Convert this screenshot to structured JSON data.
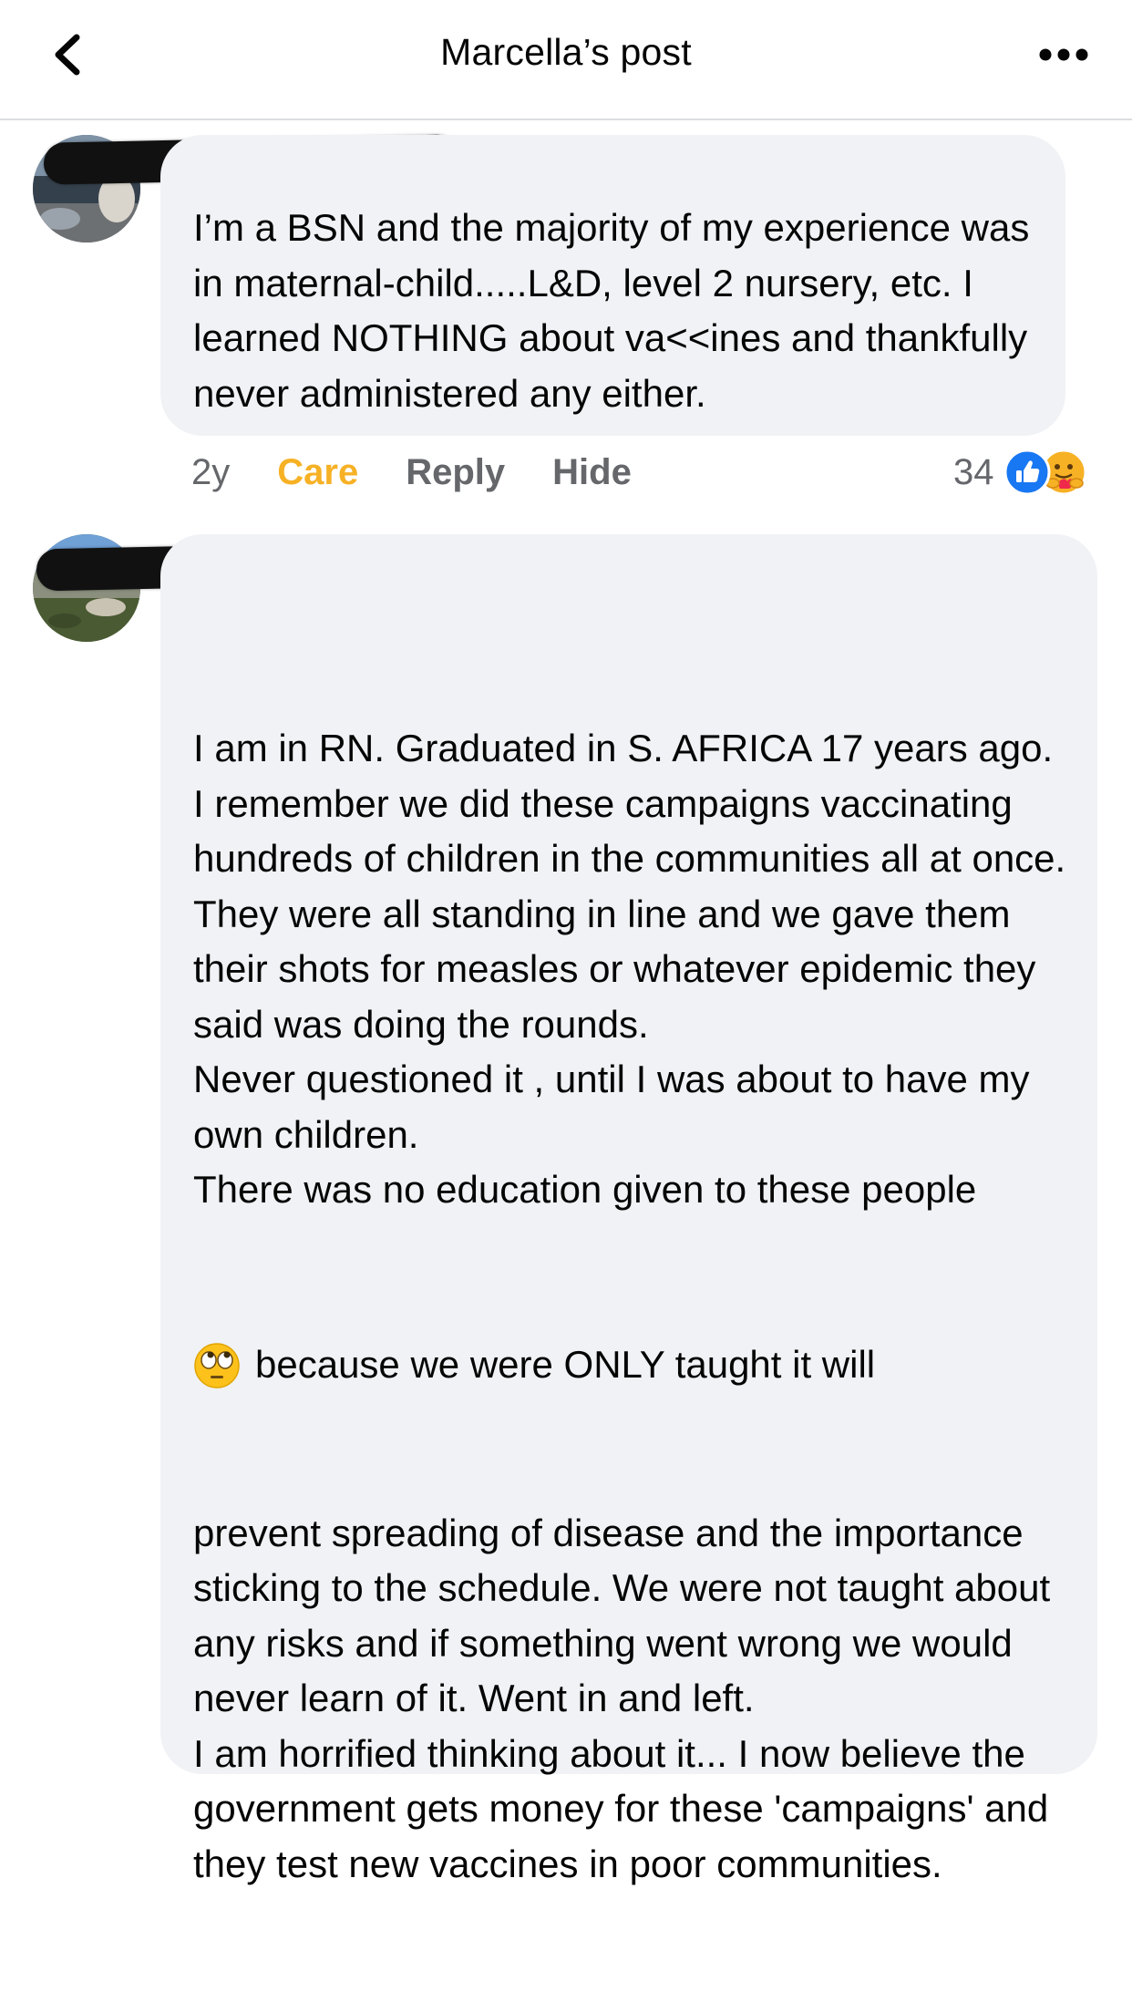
{
  "header": {
    "title": "Marcella’s post",
    "back_icon": "chevron-left-icon",
    "more_icon": "more-horizontal-icon"
  },
  "comments": [
    {
      "text": "I’m a BSN and the majority of my experience was in maternal-child.....L&D, level 2 nursery, etc. I learned NOTHING about va<<ines and thankfully never administered any either.",
      "time": "2y",
      "reaction_label": "Care",
      "reply_label": "Reply",
      "hide_label": "Hide",
      "reaction_count": "34",
      "reaction_icons": [
        "like-icon",
        "care-icon"
      ]
    },
    {
      "text_part1": "I am in RN. Graduated in S. AFRICA 17 years ago. I remember we did these campaigns vaccinating hundreds of children in the communities all at once. They were all standing in line and we gave them their shots for measles or whatever epidemic they said was doing the rounds.\nNever questioned it , until I was about to have my own children.\nThere was no education given to these people",
      "emoji": "eye-roll-emoji",
      "text_emoji_line": "because we were ONLY taught it will",
      "text_part2": "prevent spreading of disease and the importance sticking to the schedule. We were not taught about any risks and if something went wrong we would never learn of it. Went in and left.\nI am horrified thinking about it... I now believe the government gets money for these 'campaigns' and they test new vaccines in poor communities."
    }
  ],
  "colors": {
    "bubble": "#f0f2f5",
    "meta_text": "#65676b",
    "care": "#f7b125",
    "like_blue": "#1877f2"
  }
}
